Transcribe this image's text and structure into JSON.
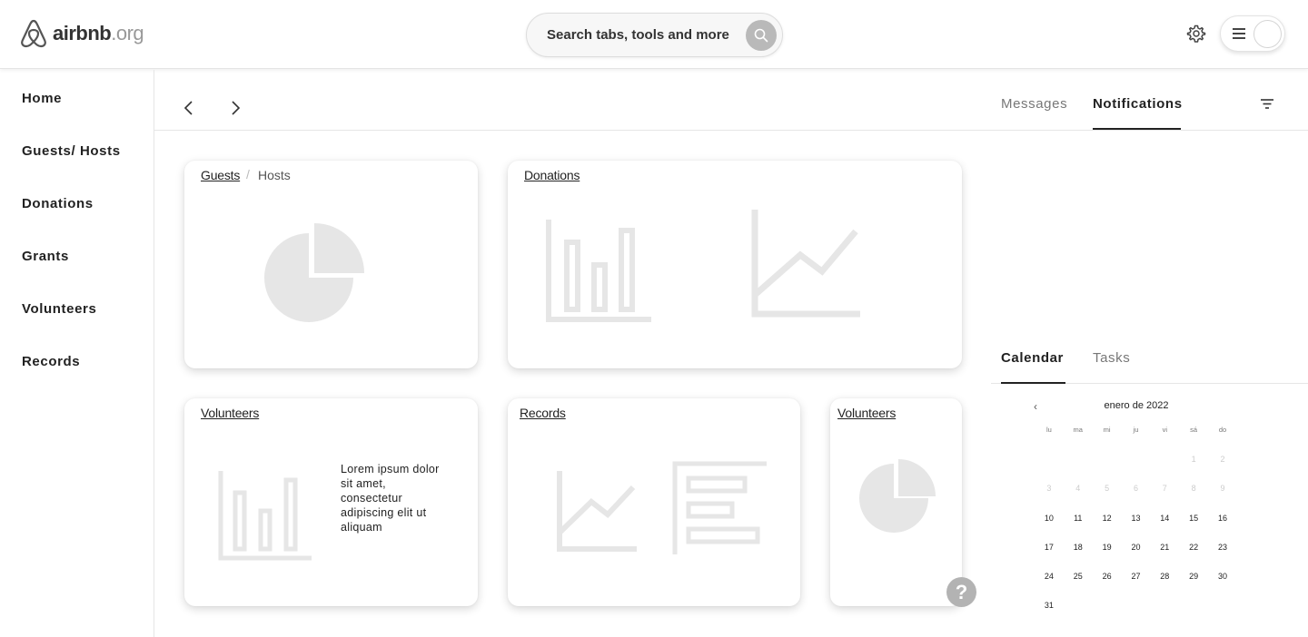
{
  "header": {
    "logo_brand": "airbnb",
    "logo_tld": ".org",
    "search_label": "Search tabs, tools and more"
  },
  "sidebar": {
    "items": [
      "Home",
      "Guests/ Hosts",
      "Donations",
      "Grants",
      "Volunteers",
      "Records"
    ]
  },
  "cards": {
    "guests": {
      "title": "Guests",
      "separator": "/",
      "sub": "Hosts"
    },
    "donations": {
      "title": "Donations"
    },
    "volunteers": {
      "title": "Volunteers",
      "text": "Lorem ipsum dolor sit amet, consectetur adipiscing elit ut aliquam"
    },
    "records": {
      "title": "Records"
    },
    "volunteers2": {
      "title": "Volunteers"
    }
  },
  "help_label": "?",
  "right_panel": {
    "tabs_top": [
      "Messages",
      "Notifications"
    ],
    "active_top": "Notifications",
    "tabs_bottom": [
      "Calendar",
      "Tasks"
    ],
    "active_bottom": "Calendar"
  },
  "calendar": {
    "prev": "‹",
    "month_label": "enero de 2022",
    "weekdays": [
      "lu",
      "ma",
      "mi",
      "ju",
      "vi",
      "sá",
      "do"
    ],
    "prev_month_days": [
      "1",
      "2",
      "3",
      "4",
      "5",
      "6",
      "7",
      "8",
      "9"
    ],
    "days": [
      "10",
      "11",
      "12",
      "13",
      "14",
      "15",
      "16",
      "17",
      "18",
      "19",
      "20",
      "21",
      "22",
      "23",
      "24",
      "25",
      "26",
      "27",
      "28",
      "29",
      "30",
      "31"
    ]
  },
  "colors": {
    "accent": "#222222",
    "placeholder_gray": "#e6e6e6",
    "help_bg": "#b3b3b3"
  }
}
